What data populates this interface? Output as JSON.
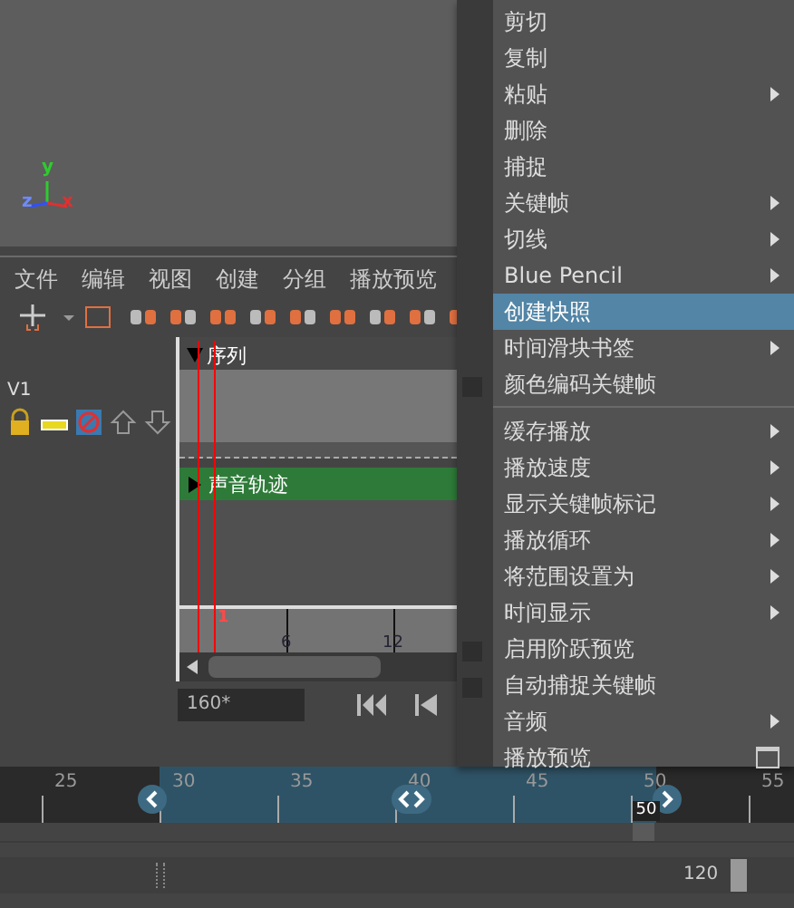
{
  "viewport": {
    "axes": [
      "y",
      "z",
      "x"
    ]
  },
  "editor": {
    "menu_bar": [
      "文件",
      "编辑",
      "视图",
      "创建",
      "分组",
      "播放预览"
    ],
    "track_label": "V1",
    "sequence_header": "序列",
    "audio_track": "声音轨迹",
    "ruler": [
      "1",
      "6",
      "12"
    ],
    "current_time": "160*"
  },
  "context_menu": [
    {
      "label": "剪切",
      "kind": "action",
      "selected": false,
      "separator_after": false
    },
    {
      "label": "复制",
      "kind": "action",
      "selected": false,
      "separator_after": false
    },
    {
      "label": "粘贴",
      "kind": "submenu",
      "selected": false,
      "separator_after": false
    },
    {
      "label": "删除",
      "kind": "action",
      "selected": false,
      "separator_after": false
    },
    {
      "label": "捕捉",
      "kind": "action",
      "selected": false,
      "separator_after": false
    },
    {
      "label": "关键帧",
      "kind": "submenu",
      "selected": false,
      "separator_after": false
    },
    {
      "label": "切线",
      "kind": "submenu",
      "selected": false,
      "separator_after": false
    },
    {
      "label": "Blue Pencil",
      "kind": "submenu",
      "selected": false,
      "separator_after": false
    },
    {
      "label": "创建快照",
      "kind": "action",
      "selected": true,
      "separator_after": false
    },
    {
      "label": "时间滑块书签",
      "kind": "submenu",
      "selected": false,
      "separator_after": false
    },
    {
      "label": "颜色编码关键帧",
      "kind": "checkbox",
      "checked": false,
      "selected": false,
      "separator_after": true
    },
    {
      "label": "缓存播放",
      "kind": "submenu",
      "selected": false,
      "separator_after": false
    },
    {
      "label": "播放速度",
      "kind": "submenu",
      "selected": false,
      "separator_after": false
    },
    {
      "label": "显示关键帧标记",
      "kind": "submenu",
      "selected": false,
      "separator_after": false
    },
    {
      "label": "播放循环",
      "kind": "submenu",
      "selected": false,
      "separator_after": false
    },
    {
      "label": "将范围设置为",
      "kind": "submenu",
      "selected": false,
      "separator_after": false
    },
    {
      "label": "时间显示",
      "kind": "submenu",
      "selected": false,
      "separator_after": false
    },
    {
      "label": "启用阶跃预览",
      "kind": "checkbox",
      "checked": false,
      "selected": false,
      "separator_after": false
    },
    {
      "label": "自动捕捉关键帧",
      "kind": "checkbox",
      "checked": false,
      "selected": false,
      "separator_after": false
    },
    {
      "label": "音频",
      "kind": "submenu",
      "selected": false,
      "separator_after": false
    },
    {
      "label": "播放预览",
      "kind": "option_box",
      "selected": false,
      "separator_after": false
    }
  ],
  "time_slider": {
    "labels": [
      "25",
      "30",
      "35",
      "40",
      "45",
      "50",
      "55"
    ],
    "current_frame": "50",
    "level": 0.81
  },
  "range_slider": {
    "end": "120",
    "level": 0.93
  }
}
